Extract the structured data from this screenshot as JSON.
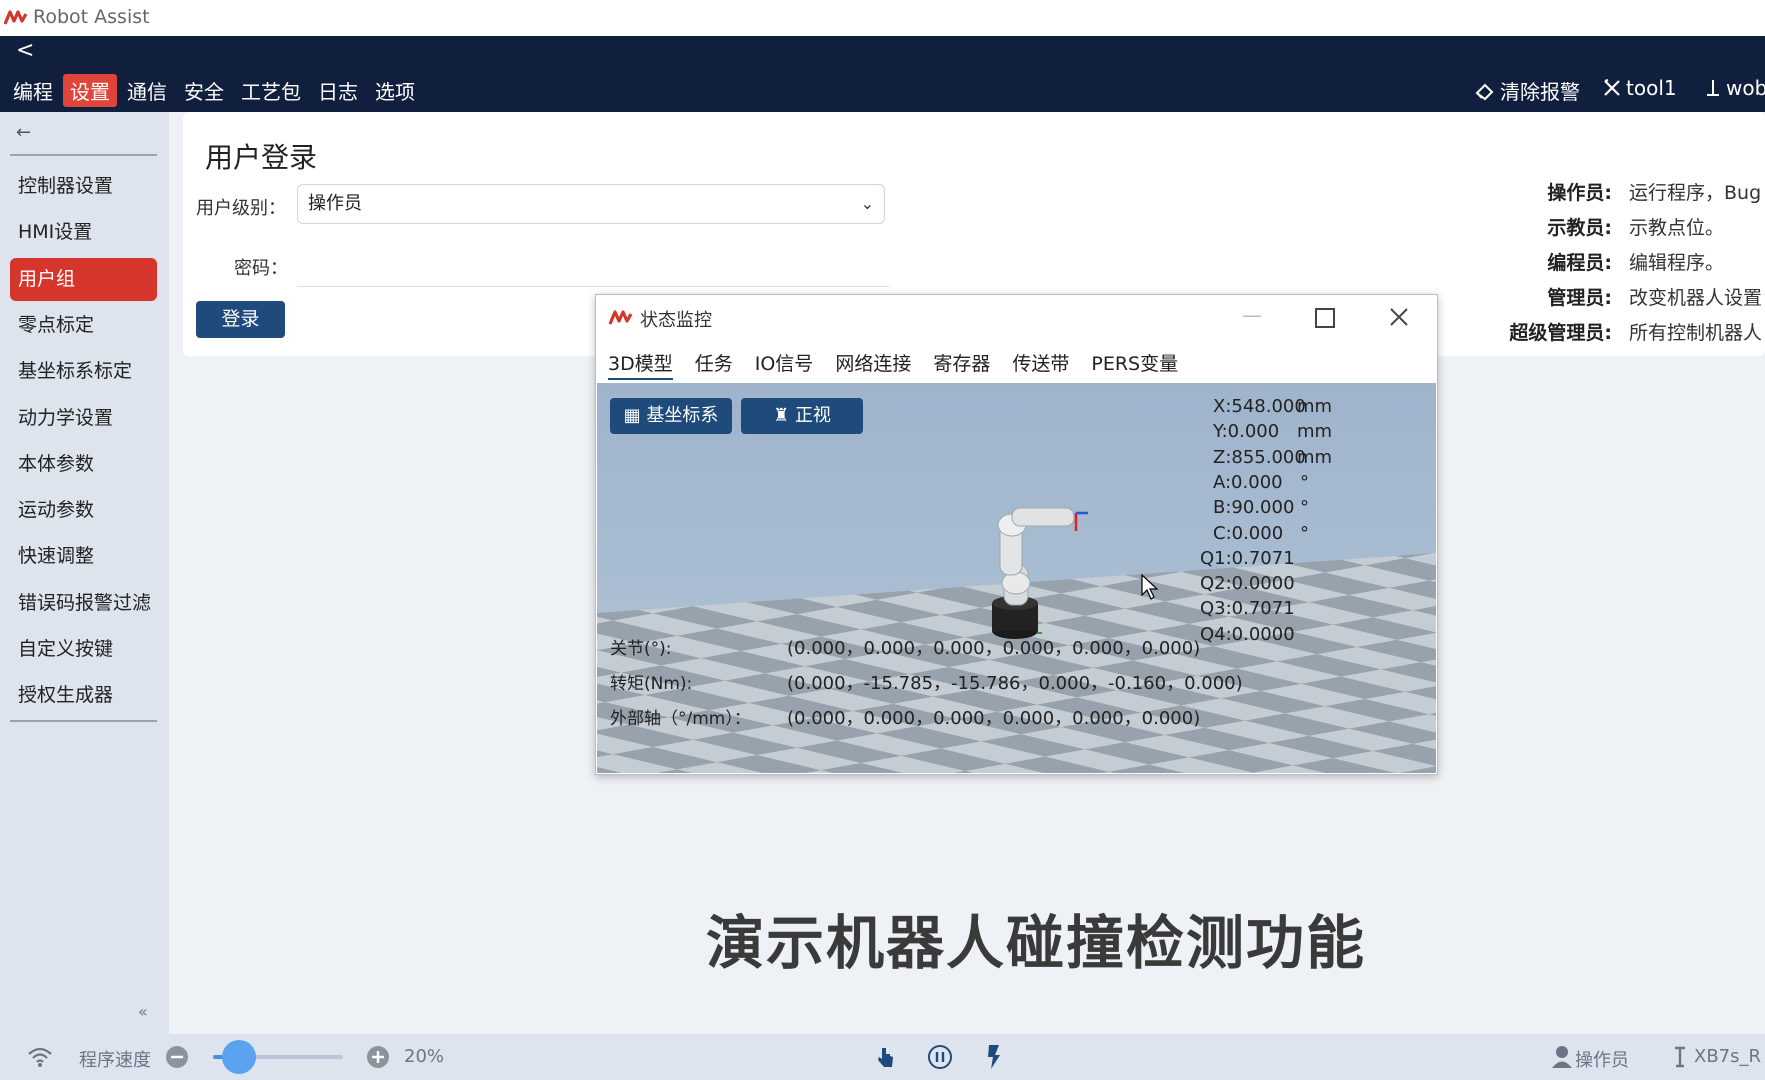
{
  "app": {
    "title": "Robot Assist",
    "logo_icon": "robot-assist-logo-icon"
  },
  "topnav": {
    "back": "<",
    "menu": [
      "编程",
      "设置",
      "通信",
      "安全",
      "工艺包",
      "日志",
      "选项"
    ],
    "active_index": 1,
    "right": {
      "clear_alarm": "清除报警",
      "tool": "tool1",
      "wobj": "wob"
    }
  },
  "sidebar": {
    "items": [
      "控制器设置",
      "HMI设置",
      "用户组",
      "零点标定",
      "基坐标系标定",
      "动力学设置",
      "本体参数",
      "运动参数",
      "快速调整",
      "错误码报警过滤",
      "自定义按键",
      "授权生成器"
    ],
    "active_index": 2,
    "collapse": "«"
  },
  "login": {
    "title": "用户登录",
    "level_label": "用户级别：",
    "level_value": "操作员",
    "password_label": "密码：",
    "login_button": "登录"
  },
  "roles": [
    {
      "name": "操作员:",
      "desc": "运行程序，Bug"
    },
    {
      "name": "示教员:",
      "desc": "示教点位。"
    },
    {
      "name": "编程员:",
      "desc": "编辑程序。"
    },
    {
      "name": "管理员:",
      "desc": "改变机器人设置"
    },
    {
      "name": "超级管理员:",
      "desc": "所有控制机器人"
    }
  ],
  "monitor": {
    "title": "状态监控",
    "tabs": [
      "3D模型",
      "任务",
      "IO信号",
      "网络连接",
      "寄存器",
      "传送带",
      "PERS变量"
    ],
    "active_tab": 0,
    "buttons": {
      "base": "基坐标系",
      "front": "正视"
    },
    "coords": [
      {
        "label": "X:548.000",
        "unit": "mm"
      },
      {
        "label": "Y:0.000",
        "unit": "mm"
      },
      {
        "label": "Z:855.000",
        "unit": "mm"
      },
      {
        "label": "A:0.000",
        "unit": "°"
      },
      {
        "label": "B:90.000",
        "unit": "°"
      },
      {
        "label": "C:0.000",
        "unit": "°"
      },
      {
        "label": "Q1:0.7071",
        "unit": ""
      },
      {
        "label": "Q2:0.0000",
        "unit": ""
      },
      {
        "label": "Q3:0.7071",
        "unit": ""
      },
      {
        "label": "Q4:0.0000",
        "unit": ""
      }
    ],
    "rows": [
      {
        "k": "关节(°):",
        "v": "(0.000，0.000，0.000，0.000，0.000，0.000)"
      },
      {
        "k": "转矩(Nm):",
        "v": "(0.000，-15.785，-15.786，0.000，-0.160，0.000)"
      },
      {
        "k": "外部轴（°/mm）：",
        "v": "(0.000，0.000，0.000，0.000，0.000，0.000)"
      }
    ]
  },
  "caption": "演示机器人碰撞检测功能",
  "bottombar": {
    "speed_label": "程序速度",
    "speed_value": "20%",
    "speed_fraction": 0.2,
    "user": "操作员",
    "device": "XB7s_R"
  },
  "colors": {
    "nav_bg": "#0f1f3d",
    "accent_red": "#d5352b",
    "button_blue": "#1e4a7c"
  }
}
